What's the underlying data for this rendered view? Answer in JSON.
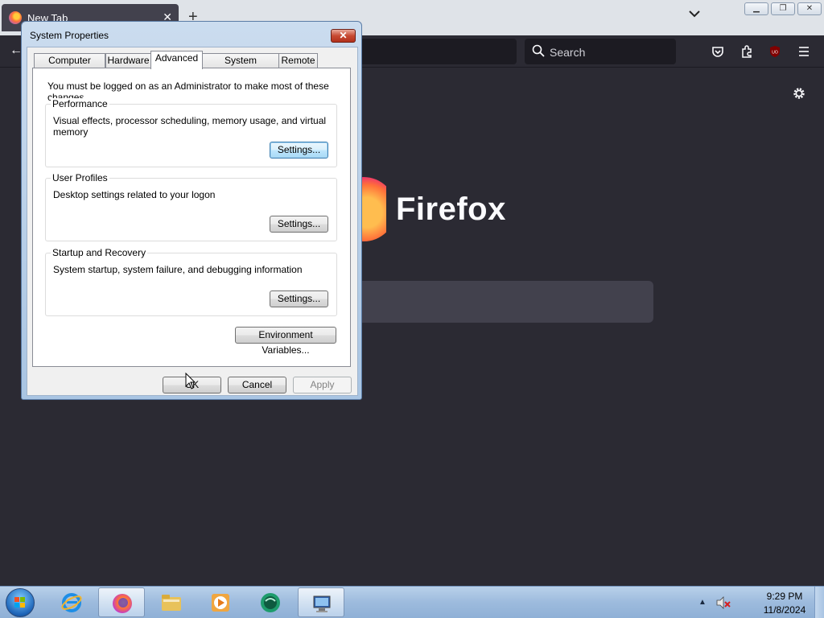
{
  "firefox": {
    "tab_title": "New Tab",
    "search_placeholder": "Search",
    "wordmark": "Firefox",
    "ublock_badge": "UO"
  },
  "dialog": {
    "title": "System Properties",
    "close_label": "✕",
    "tabs": [
      "Computer Name",
      "Hardware",
      "Advanced",
      "System Protection",
      "Remote"
    ],
    "active_tab": "Advanced",
    "admin_note": "You must be logged on as an Administrator to make most of these changes.",
    "groups": {
      "performance": {
        "legend": "Performance",
        "description": "Visual effects, processor scheduling, memory usage, and virtual memory",
        "button": "Settings..."
      },
      "user_profiles": {
        "legend": "User Profiles",
        "description": "Desktop settings related to your logon",
        "button": "Settings..."
      },
      "startup": {
        "legend": "Startup and Recovery",
        "description": "System startup, system failure, and debugging information",
        "button": "Settings..."
      }
    },
    "env_vars_button": "Environment Variables...",
    "ok_button": "OK",
    "cancel_button": "Cancel",
    "apply_button": "Apply"
  },
  "taskbar": {
    "clock_time": "9:29 PM",
    "clock_date": "11/8/2024",
    "tray_arrow": "▲"
  },
  "colors": {
    "firefox_bg": "#2b2a33",
    "dialog_frame": "#a9c5e3",
    "taskbar": "#9dbbdd"
  }
}
